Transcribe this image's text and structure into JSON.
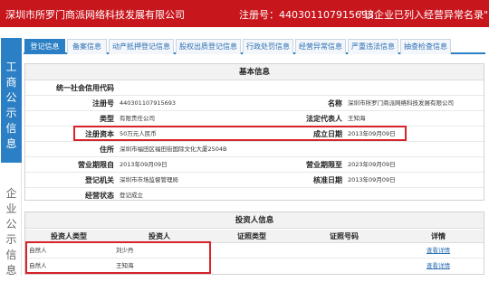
{
  "header": {
    "company_name": "深圳市所罗门商派网络科技发展有限公司",
    "reg_no_text": "注册号：440301107915693",
    "notice_text": "\"该企业已列入经营异常名录\""
  },
  "sidebar": {
    "section_active": "工商公示信息",
    "section_inactive": "企业公示信息"
  },
  "tabs": [
    {
      "label": "登记信息"
    },
    {
      "label": "备案信息"
    },
    {
      "label": "动产抵押登记信息"
    },
    {
      "label": "股权出质登记信息"
    },
    {
      "label": "行政处罚信息"
    },
    {
      "label": "经营异常信息"
    },
    {
      "label": "严重违法信息"
    },
    {
      "label": "抽查检查信息"
    }
  ],
  "basic_info": {
    "title": "基本信息",
    "credit_code_label": "统一社会信用代码",
    "credit_code_value": "",
    "reg_no_label": "注册号",
    "reg_no_value": "440301107915693",
    "name_label": "名称",
    "name_value": "深圳市所罗门商派网络科技发展有限公司",
    "type_label": "类型",
    "type_value": "有限责任公司",
    "legal_rep_label": "法定代表人",
    "legal_rep_value": "王知海",
    "capital_label": "注册资本",
    "capital_value": "50万元人民币",
    "est_date_label": "成立日期",
    "est_date_value": "2013年09月09日",
    "address_label": "住所",
    "address_value": "深圳市福田区福田街国际文化大厦2504B",
    "term_from_label": "营业期限自",
    "term_from_value": "2013年09月09日",
    "term_to_label": "营业期限至",
    "term_to_value": "2023年09月09日",
    "authority_label": "登记机关",
    "authority_value": "深圳市市场监督管理局",
    "approval_date_label": "核准日期",
    "approval_date_value": "2013年09月09日",
    "status_label": "经营状态",
    "status_value": "登记成立"
  },
  "investors": {
    "title": "投资人信息",
    "columns": [
      "投资人类型",
      "投资人",
      "证照类型",
      "证照号码",
      "详情"
    ],
    "rows": [
      {
        "type": "自然人",
        "name": "刘少丹",
        "id_type": "",
        "id_no": "",
        "detail": "查看详情"
      },
      {
        "type": "自然人",
        "name": "王知海",
        "id_type": "",
        "id_no": "",
        "detail": "查看详情"
      }
    ]
  },
  "colors": {
    "header_red": "#c8161d",
    "tab_blue": "#2b7fc4",
    "highlight_red": "#d8232a"
  }
}
